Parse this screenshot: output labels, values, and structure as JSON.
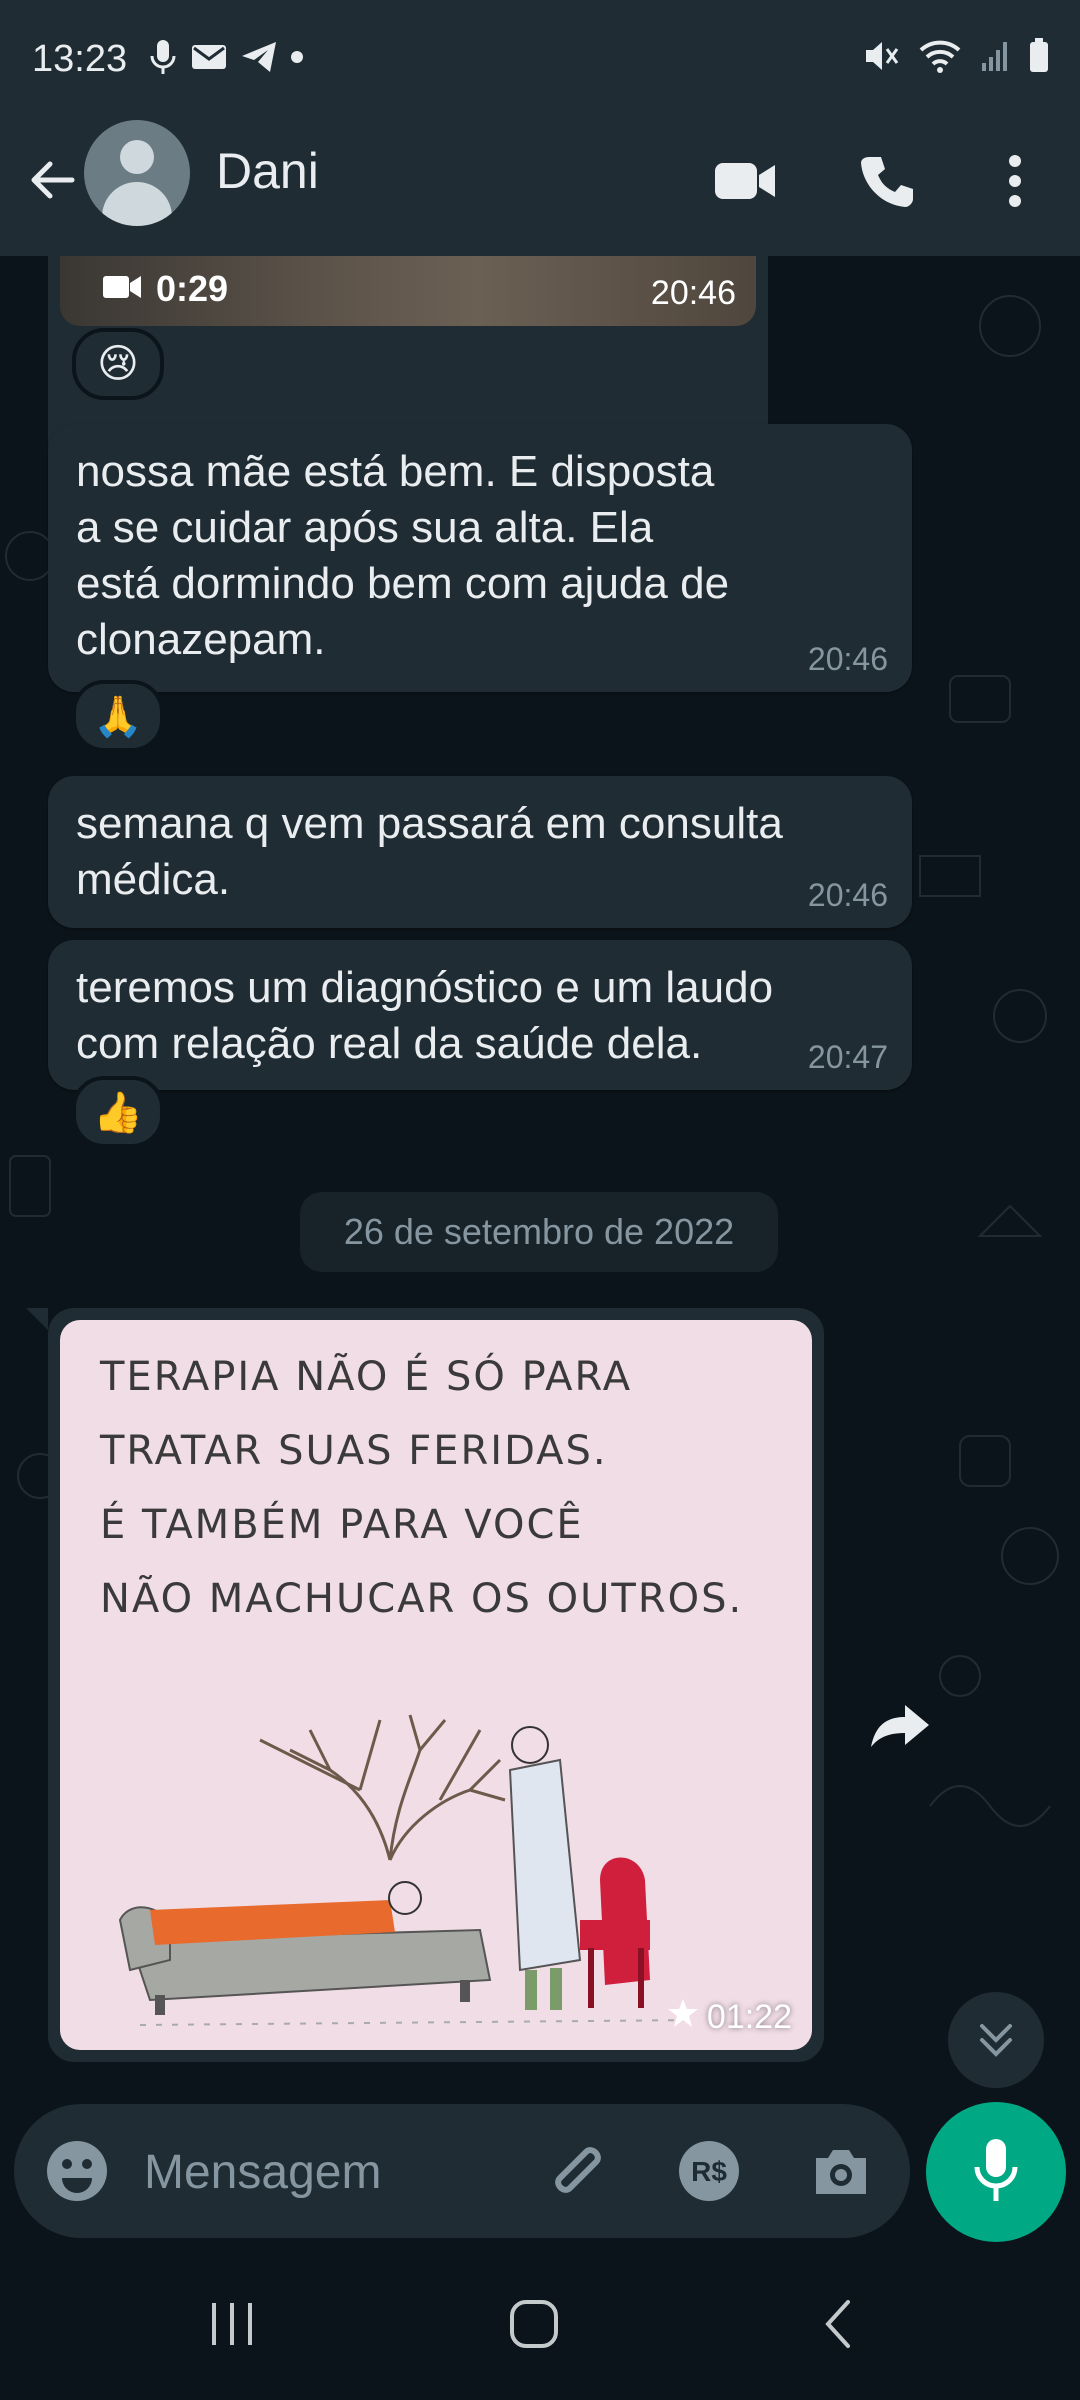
{
  "status_bar": {
    "time": "13:23"
  },
  "header": {
    "contact_name": "Dani"
  },
  "messages": [
    {
      "type": "video",
      "duration": "0:29",
      "time": "20:46",
      "reaction": "😢"
    },
    {
      "type": "text",
      "text": "nossa mãe está bem. E disposta\na se cuidar após sua alta. Ela\nestá dormindo bem com ajuda de\nclonazepam.",
      "time": "20:46",
      "reaction": "🙏"
    },
    {
      "type": "text",
      "text": "semana q vem passará em consulta\nmédica.",
      "time": "20:46"
    },
    {
      "type": "text",
      "text": "teremos um diagnóstico e um laudo\ncom relação real da saúde dela.",
      "time": "20:47",
      "reaction": "👍"
    }
  ],
  "date_separator": "26 de setembro de 2022",
  "image_message": {
    "image_text": "TERAPIA NÃO É SÓ PARA\nTRATAR SUAS FERIDAS.\nÉ TAMBÉM PARA VOCÊ\nNÃO MACHUCAR OS OUTROS.",
    "time": "01:22",
    "starred": true
  },
  "composer": {
    "placeholder": "Mensagem"
  },
  "colors": {
    "background": "#0b141a",
    "bar": "#1f2c34",
    "bubble": "#202c33",
    "accent": "#00a884",
    "muted_text": "#8696a0"
  },
  "icons": [
    "mic-icon",
    "mail-icon",
    "telegram-icon",
    "mute-icon",
    "wifi-icon",
    "signal-icon",
    "battery-icon",
    "back-arrow-icon",
    "video-call-icon",
    "phone-icon",
    "more-icon",
    "video-camera-icon",
    "star-icon",
    "forward-icon",
    "chevron-double-down-icon",
    "emoji-icon",
    "paperclip-icon",
    "pay-icon",
    "camera-icon",
    "recents-icon",
    "home-icon",
    "back-icon"
  ]
}
